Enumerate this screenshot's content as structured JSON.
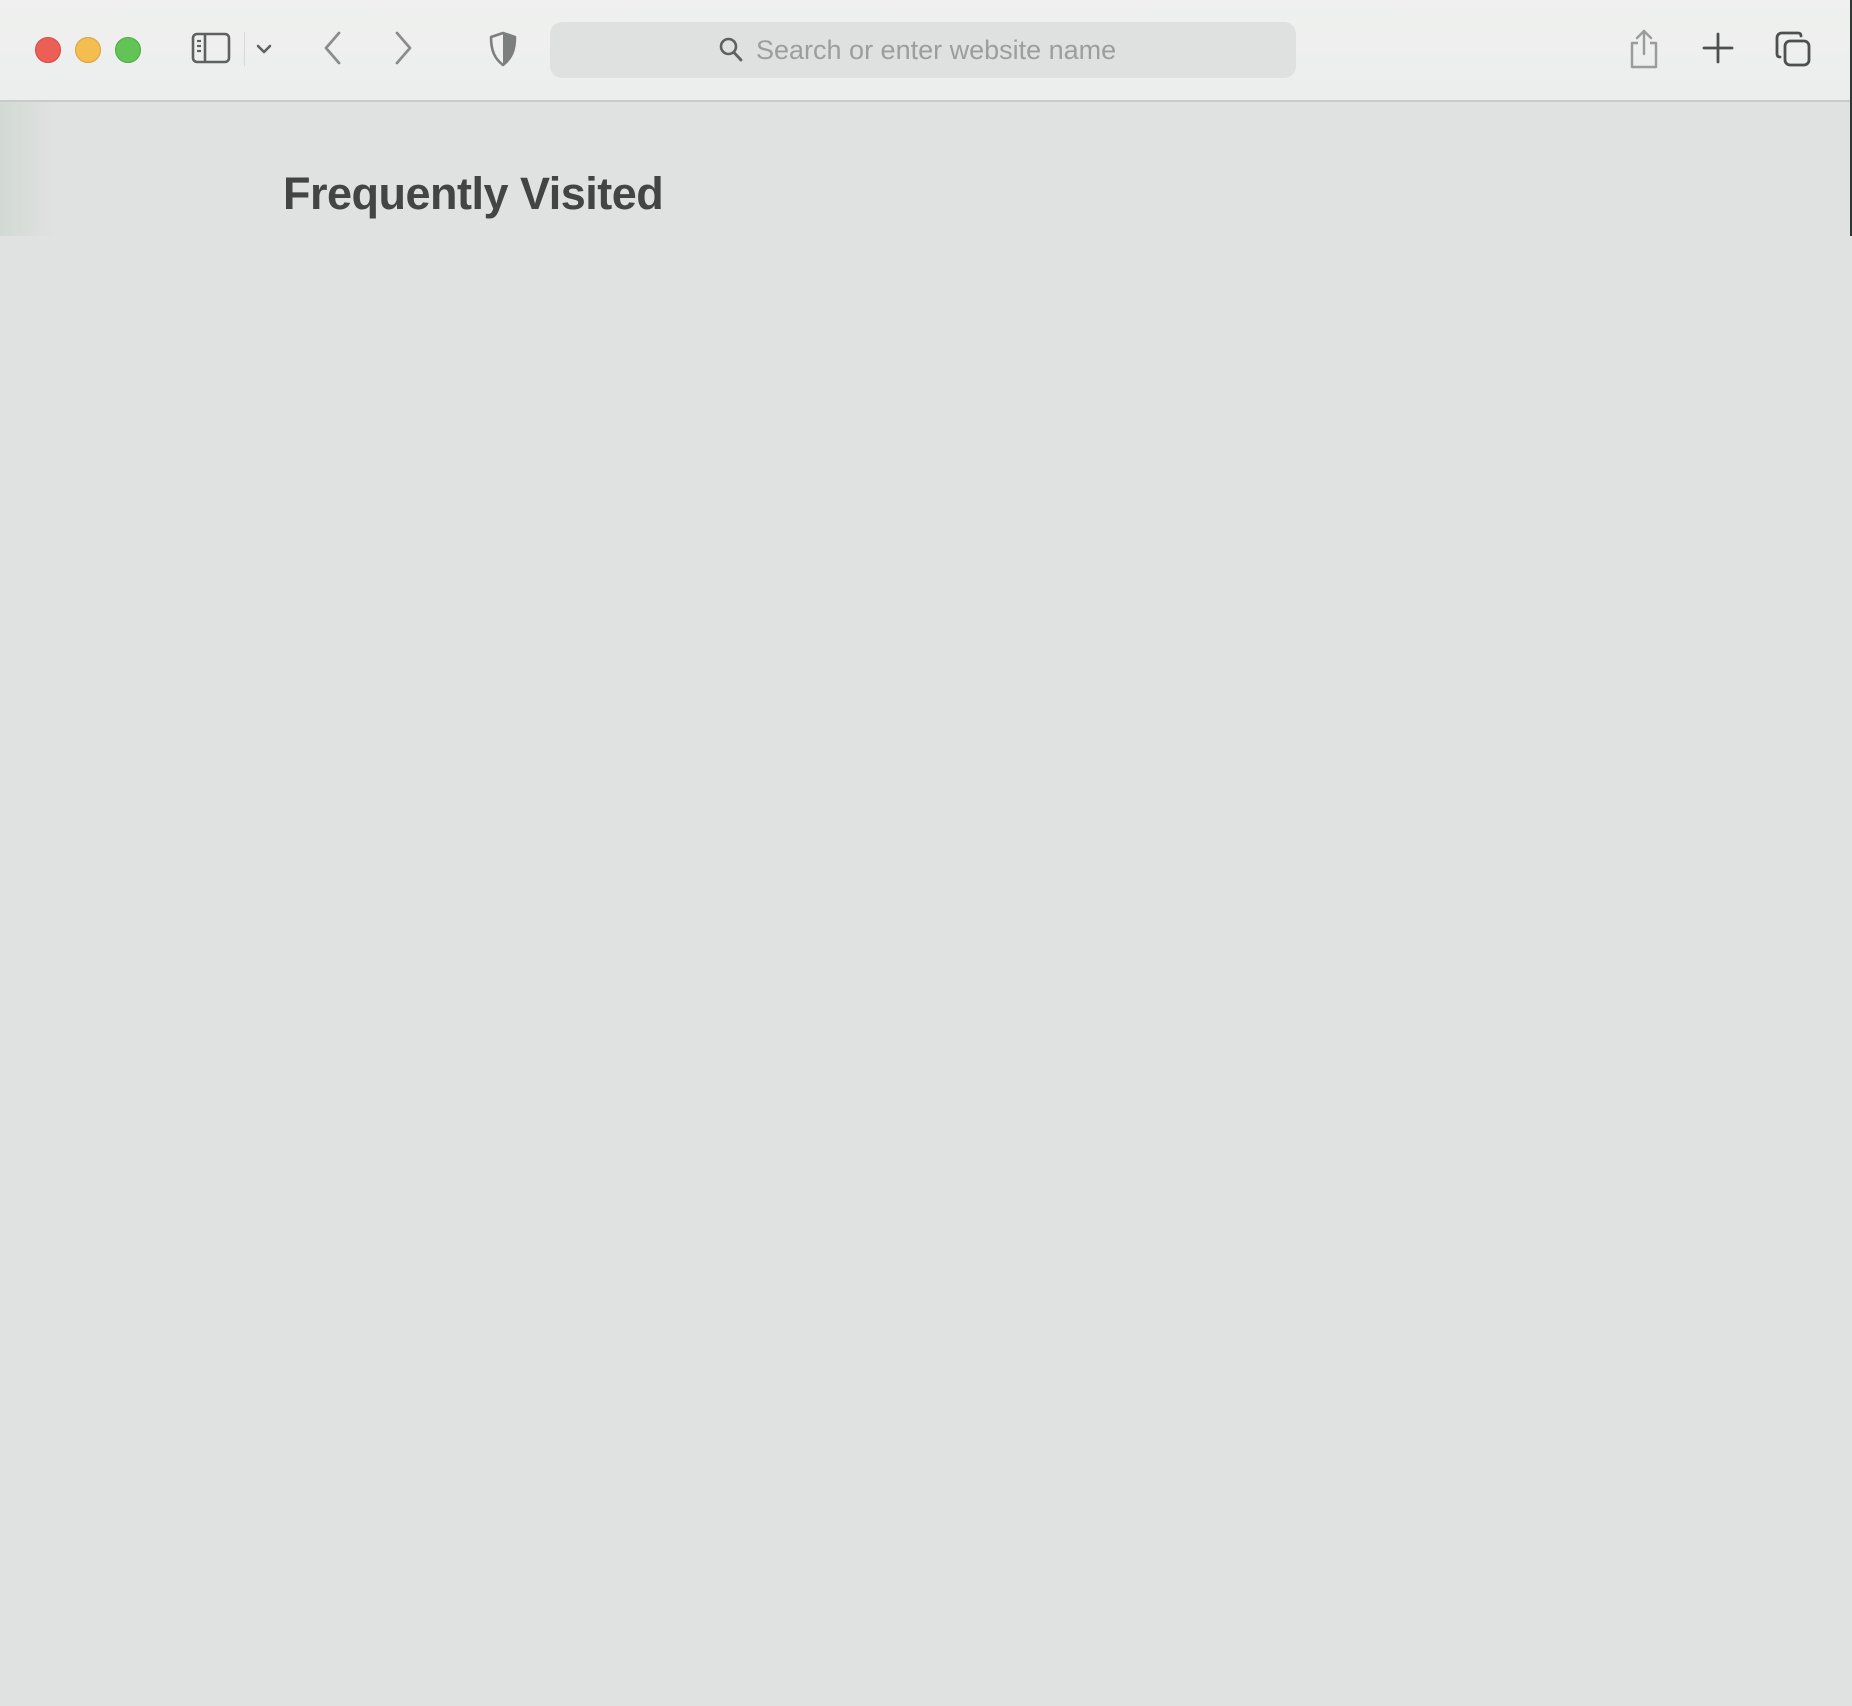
{
  "window": {
    "traffic_lights": {
      "close_color": "#ec5f57",
      "minimize_color": "#f4bd4f",
      "maximize_color": "#62c454"
    }
  },
  "toolbar": {
    "icons": {
      "sidebar": "sidebar-icon",
      "sidebar_menu": "chevron-down-icon",
      "back": "chevron-left-icon",
      "forward": "chevron-right-icon",
      "privacy": "shield-icon",
      "share": "share-icon",
      "new_tab": "plus-icon",
      "tab_overview": "tab-overview-icon"
    }
  },
  "address_bar": {
    "placeholder": "Search or enter website name",
    "value": "",
    "icon": "search-icon"
  },
  "start_page": {
    "section_title": "Frequently Visited",
    "items": []
  }
}
